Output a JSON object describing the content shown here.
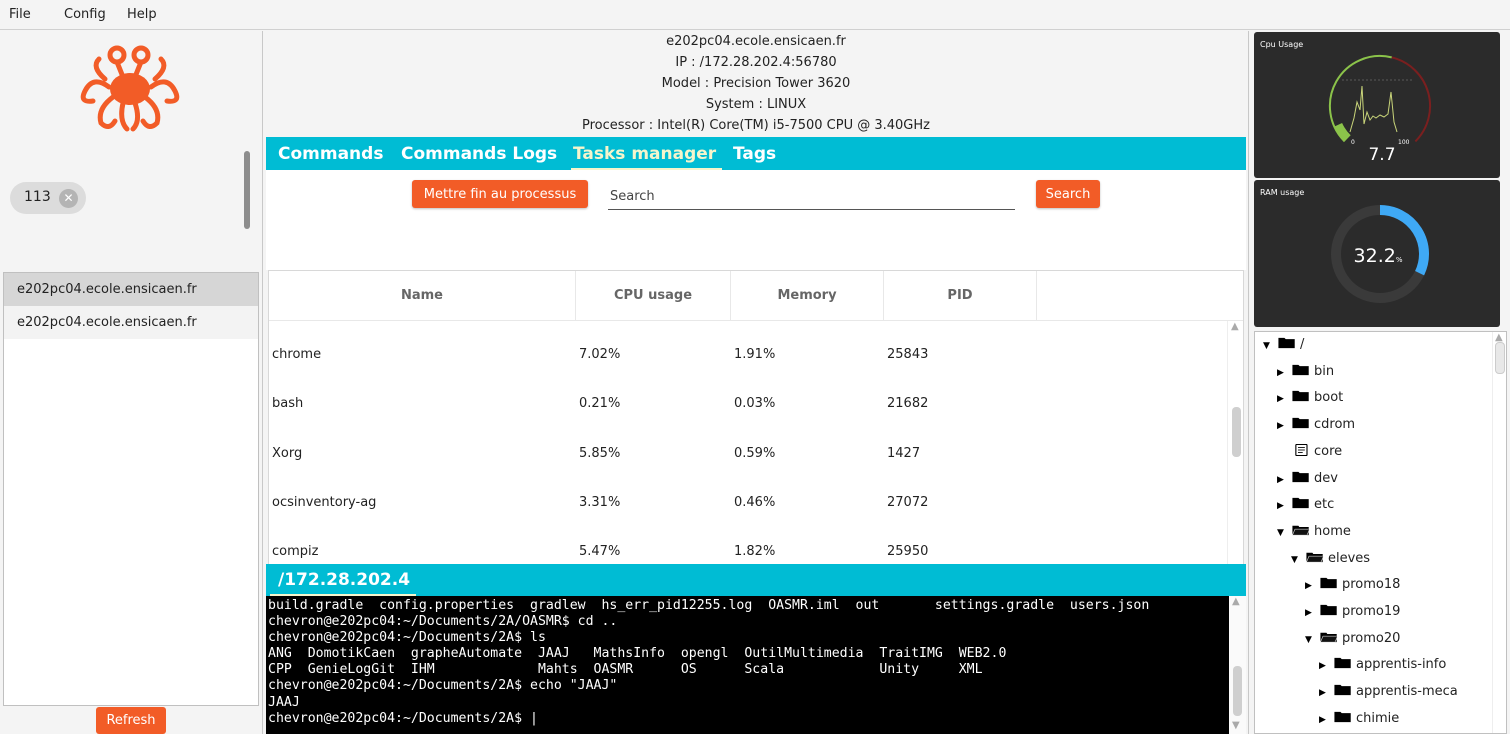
{
  "menu": [
    "File",
    "Config",
    "Help"
  ],
  "left": {
    "chip_label": "113",
    "hosts": [
      "e202pc04.ecole.ensicaen.fr",
      "e202pc04.ecole.ensicaen.fr"
    ],
    "refresh_label": "Refresh"
  },
  "info": {
    "hostname": "e202pc04.ecole.ensicaen.fr",
    "ip": "IP : /172.28.202.4:56780",
    "model": "Model : Precision Tower 3620",
    "system": "System : LINUX",
    "processor": "Processor : Intel(R) Core(TM) i5-7500 CPU @ 3.40GHz"
  },
  "tabs": [
    "Commands",
    "Commands Logs",
    "Tasks manager",
    "Tags"
  ],
  "active_tab": "Tasks manager",
  "toolbar": {
    "kill_label": "Mettre fin au processus",
    "search_placeholder": "Search",
    "search_label": "Search"
  },
  "table": {
    "columns": [
      "Name",
      "CPU usage",
      "Memory",
      "PID"
    ],
    "rows": [
      [
        "chrome",
        "7.02%",
        "1.91%",
        "25843"
      ],
      [
        "bash",
        "0.21%",
        "0.03%",
        "21682"
      ],
      [
        "Xorg",
        "5.85%",
        "0.59%",
        "1427"
      ],
      [
        "ocsinventory-ag",
        "3.31%",
        "0.46%",
        "27072"
      ],
      [
        "compiz",
        "5.47%",
        "1.82%",
        "25950"
      ]
    ]
  },
  "terminal": {
    "tab_label": "/172.28.202.4",
    "lines": [
      "build.gradle  config.properties  gradlew  hs_err_pid12255.log  OASMR.iml  out       settings.gradle  users.json",
      "chevron@e202pc04:~/Documents/2A/OASMR$ cd ..",
      "chevron@e202pc04:~/Documents/2A$ ls",
      "ANG  DomotikCaen  grapheAutomate  JAAJ   MathsInfo  opengl  OutilMultimedia  TraitIMG  WEB2.0",
      "CPP  GenieLogGit  IHM             Mahts  OASMR      OS      Scala            Unity     XML",
      "chevron@e202pc04:~/Documents/2A$ echo \"JAAJ\"",
      "JAAJ",
      "chevron@e202pc04:~/Documents/2A$ |"
    ]
  },
  "cpu_gauge": {
    "title": "Cpu Usage",
    "value": "7.7",
    "value_num": 7.7,
    "min_label": "0",
    "max_label": "100"
  },
  "ram_gauge": {
    "title": "RAM usage",
    "value": "32.2",
    "unit": "%",
    "percent": 32.2
  },
  "tree": [
    {
      "label": "/",
      "type": "folder",
      "expanded": true,
      "depth": 0
    },
    {
      "label": "bin",
      "type": "folder",
      "expanded": false,
      "depth": 1
    },
    {
      "label": "boot",
      "type": "folder",
      "expanded": false,
      "depth": 1
    },
    {
      "label": "cdrom",
      "type": "folder",
      "expanded": false,
      "depth": 1
    },
    {
      "label": "core",
      "type": "file",
      "depth": 1
    },
    {
      "label": "dev",
      "type": "folder",
      "expanded": false,
      "depth": 1
    },
    {
      "label": "etc",
      "type": "folder",
      "expanded": false,
      "depth": 1
    },
    {
      "label": "home",
      "type": "folder-open",
      "expanded": true,
      "depth": 1
    },
    {
      "label": "eleves",
      "type": "folder-open",
      "expanded": true,
      "depth": 2
    },
    {
      "label": "promo18",
      "type": "folder",
      "expanded": false,
      "depth": 3
    },
    {
      "label": "promo19",
      "type": "folder",
      "expanded": false,
      "depth": 3
    },
    {
      "label": "promo20",
      "type": "folder-open",
      "expanded": true,
      "depth": 3
    },
    {
      "label": "apprentis-info",
      "type": "folder",
      "expanded": false,
      "depth": 4
    },
    {
      "label": "apprentis-meca",
      "type": "folder",
      "expanded": false,
      "depth": 4
    },
    {
      "label": "chimie",
      "type": "folder",
      "expanded": false,
      "depth": 4
    }
  ],
  "colors": {
    "accent": "#00bcd4",
    "button": "#f25c27",
    "gauge_green": "#8bc34a",
    "gauge_red": "#7a1f1f",
    "ram_blue": "#3fa9f5"
  }
}
